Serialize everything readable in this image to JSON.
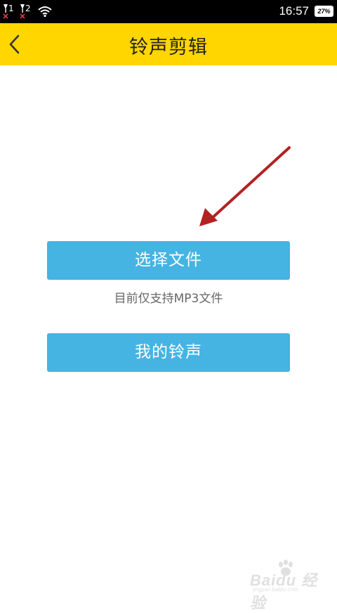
{
  "status_bar": {
    "sim1_label": "1",
    "sim2_label": "2",
    "time": "16:57",
    "battery": "27%"
  },
  "header": {
    "title": "铃声剪辑"
  },
  "main": {
    "select_file_label": "选择文件",
    "hint": "目前仅支持MP3文件",
    "my_ringtones_label": "我的铃声"
  },
  "watermark": {
    "text": "Baidu 经验",
    "sub": "jingyan.baidu.com"
  },
  "colors": {
    "title_bar": "#ffd600",
    "button": "#45b4e3",
    "arrow": "#b22222"
  }
}
